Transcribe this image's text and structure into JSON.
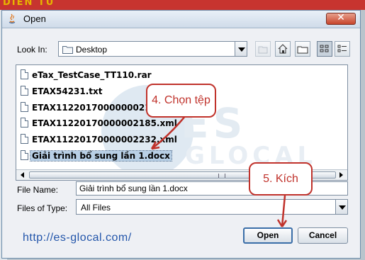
{
  "background": {
    "banner_text": "DIEN TU"
  },
  "dialog": {
    "title": "Open",
    "close_label": "✕",
    "look_in_label": "Look In:",
    "look_in_value": "Desktop",
    "toolbar": [
      "up-folder-icon",
      "home-icon",
      "new-folder-icon",
      "list-view-icon",
      "details-view-icon"
    ],
    "files": [
      {
        "name": "eTax_TestCase_TT110.rar",
        "selected": false
      },
      {
        "name": "ETAX54231.txt",
        "selected": false
      },
      {
        "name": "ETAX11220170000000217.xml",
        "selected": false
      },
      {
        "name": "ETAX11220170000002185.xml",
        "selected": false
      },
      {
        "name": "ETAX11220170000002232.xml",
        "selected": false
      },
      {
        "name": "Giải trình bổ sung lần 1.docx",
        "selected": true
      }
    ],
    "file_name_label": "File Name:",
    "file_name_value": "Giải trình bổ sung lần 1.docx",
    "files_of_type_label": "Files of Type:",
    "files_of_type_value": "All Files",
    "open_label": "Open",
    "cancel_label": "Cancel"
  },
  "watermark": {
    "line1": "ES",
    "line2": "GLOCAL",
    "url": "http://es-glocal.com/"
  },
  "annotations": {
    "step4": "4. Chọn tệp",
    "step5": "5. Kích"
  },
  "colors": {
    "callout": "#c0322b",
    "selection": "#b8cfe5",
    "url": "#2255aa"
  }
}
